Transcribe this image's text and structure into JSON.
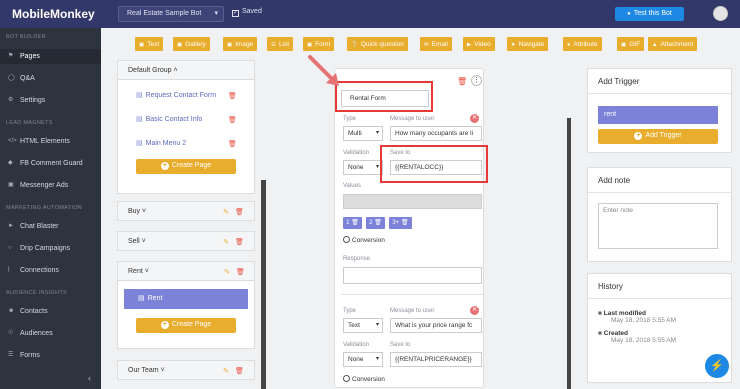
{
  "app": {
    "title": "MobileMonkey",
    "bot_name": "Real Estate Sample Bot",
    "saved_label": "Saved",
    "test_label": "Test this Bot"
  },
  "sidebar": {
    "sections": [
      {
        "title": "BOT BUILDER",
        "items": [
          {
            "label": "Pages",
            "icon": "tag-icon"
          },
          {
            "label": "Q&A",
            "icon": "chat-icon"
          },
          {
            "label": "Settings",
            "icon": "gear-icon"
          }
        ]
      },
      {
        "title": "LEAD MAGNETS",
        "items": [
          {
            "label": "HTML Elements",
            "icon": "code-icon"
          },
          {
            "label": "FB Comment Guard",
            "icon": "shield-icon"
          },
          {
            "label": "Messenger Ads",
            "icon": "ads-icon"
          }
        ]
      },
      {
        "title": "MARKETING AUTOMATION",
        "items": [
          {
            "label": "Chat Blaster",
            "icon": "megaphone-icon"
          },
          {
            "label": "Drip Campaigns",
            "icon": "drip-icon"
          },
          {
            "label": "Connections",
            "icon": "plug-icon"
          }
        ]
      },
      {
        "title": "AUDIENCE INSIGHTS",
        "items": [
          {
            "label": "Contacts",
            "icon": "contacts-icon"
          },
          {
            "label": "Audiences",
            "icon": "audience-icon"
          },
          {
            "label": "Forms",
            "icon": "forms-icon"
          }
        ]
      }
    ]
  },
  "toolbar": [
    "Text",
    "Gallery",
    "Image",
    "List",
    "Form",
    "Quick question",
    "Email",
    "Video",
    "Navigate",
    "Attribute",
    "GIF",
    "Attachment"
  ],
  "groups": {
    "default": {
      "title": "Default Group",
      "pages": [
        "Request Contact Form",
        "Basic Contact Info",
        "Main Menu 2"
      ],
      "create_label": "Create Page"
    },
    "buy": "Buy",
    "sell": "Sell",
    "rent": {
      "title": "Rent",
      "selected": "Rent",
      "create_label": "Create Page"
    },
    "team": "Our Team"
  },
  "editor": {
    "form_name": "Rental Form",
    "q1": {
      "type_label": "Type",
      "type_value": "Multi",
      "msg_label": "Message to user",
      "msg_value": "How many occupants are li",
      "validation_label": "Validation",
      "validation_value": "None",
      "save_label": "Save to",
      "save_value": "{{RENTALOCC}}",
      "values_label": "Values",
      "chips": [
        "1",
        "2",
        "3+"
      ],
      "conversion_label": "Conversion",
      "response_label": "Response"
    },
    "q2": {
      "type_label": "Type",
      "type_value": "Text",
      "msg_label": "Message to user",
      "msg_value": "What is your price range fc",
      "validation_label": "Validation",
      "validation_value": "None",
      "save_label": "Save to",
      "save_value": "{{RENTALPRICERANGE}}",
      "conversion_label": "Conversion"
    }
  },
  "right": {
    "trigger": {
      "title": "Add Trigger",
      "value": "rent",
      "button": "Add Trigger"
    },
    "note": {
      "title": "Add note",
      "placeholder": "Enter note"
    },
    "history": {
      "title": "History",
      "entries": [
        {
          "label": "Last modified",
          "date": "May 18, 2018 5:55 AM"
        },
        {
          "label": "Created",
          "date": "May 18, 2018 5:55 AM"
        }
      ]
    }
  },
  "colors": {
    "sidebar": "#2e3340",
    "topbar": "#32386a",
    "accent": "#e8ad2c",
    "purple": "#7b82d8",
    "highlight": "#e53935"
  }
}
